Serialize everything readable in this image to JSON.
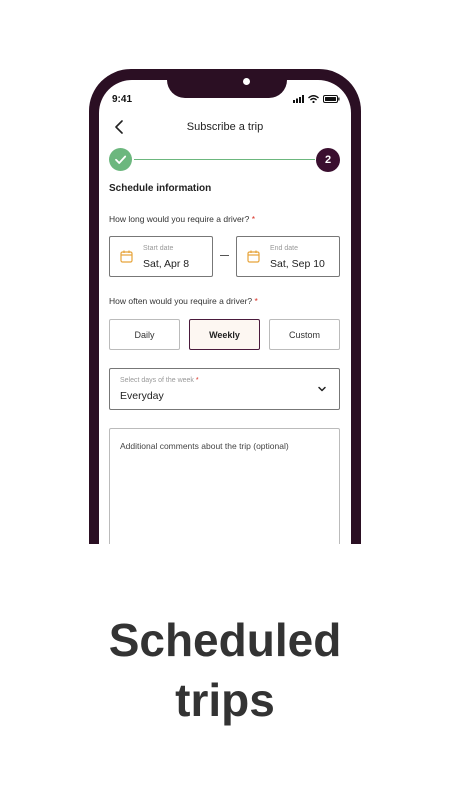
{
  "status_bar": {
    "time": "9:41",
    "icons": [
      "signal-icon",
      "wifi-icon",
      "battery-icon"
    ]
  },
  "header": {
    "title": "Subscribe a trip",
    "back_icon": "chevron-left-icon"
  },
  "stepper": {
    "current_step": "2",
    "completed_icon": "check-icon",
    "accent_done": "#6cb77e",
    "accent_current": "#3a0f2f"
  },
  "form": {
    "section_title": "Schedule information",
    "duration_question": "How long would you require a driver?",
    "required_mark": "*",
    "start_date": {
      "label": "Start date",
      "value": "Sat, Apr 8",
      "icon": "calendar-icon"
    },
    "end_date": {
      "label": "End date",
      "value": "Sat, Sep 10",
      "icon": "calendar-icon"
    },
    "frequency_question": "How often would you require a driver?",
    "frequency_options": [
      "Daily",
      "Weekly",
      "Custom"
    ],
    "frequency_selected": "Weekly",
    "days_select": {
      "label": "Select days of the week",
      "value": "Everyday",
      "icon": "chevron-down-icon"
    },
    "comments_placeholder": "Additional comments about the trip (optional)"
  },
  "marketing": {
    "headline_line1": "Scheduled",
    "headline_line2": "trips"
  },
  "colors": {
    "brand": "#3a0f2f",
    "calendar_icon": "#e7a43a",
    "required": "#d93025"
  }
}
